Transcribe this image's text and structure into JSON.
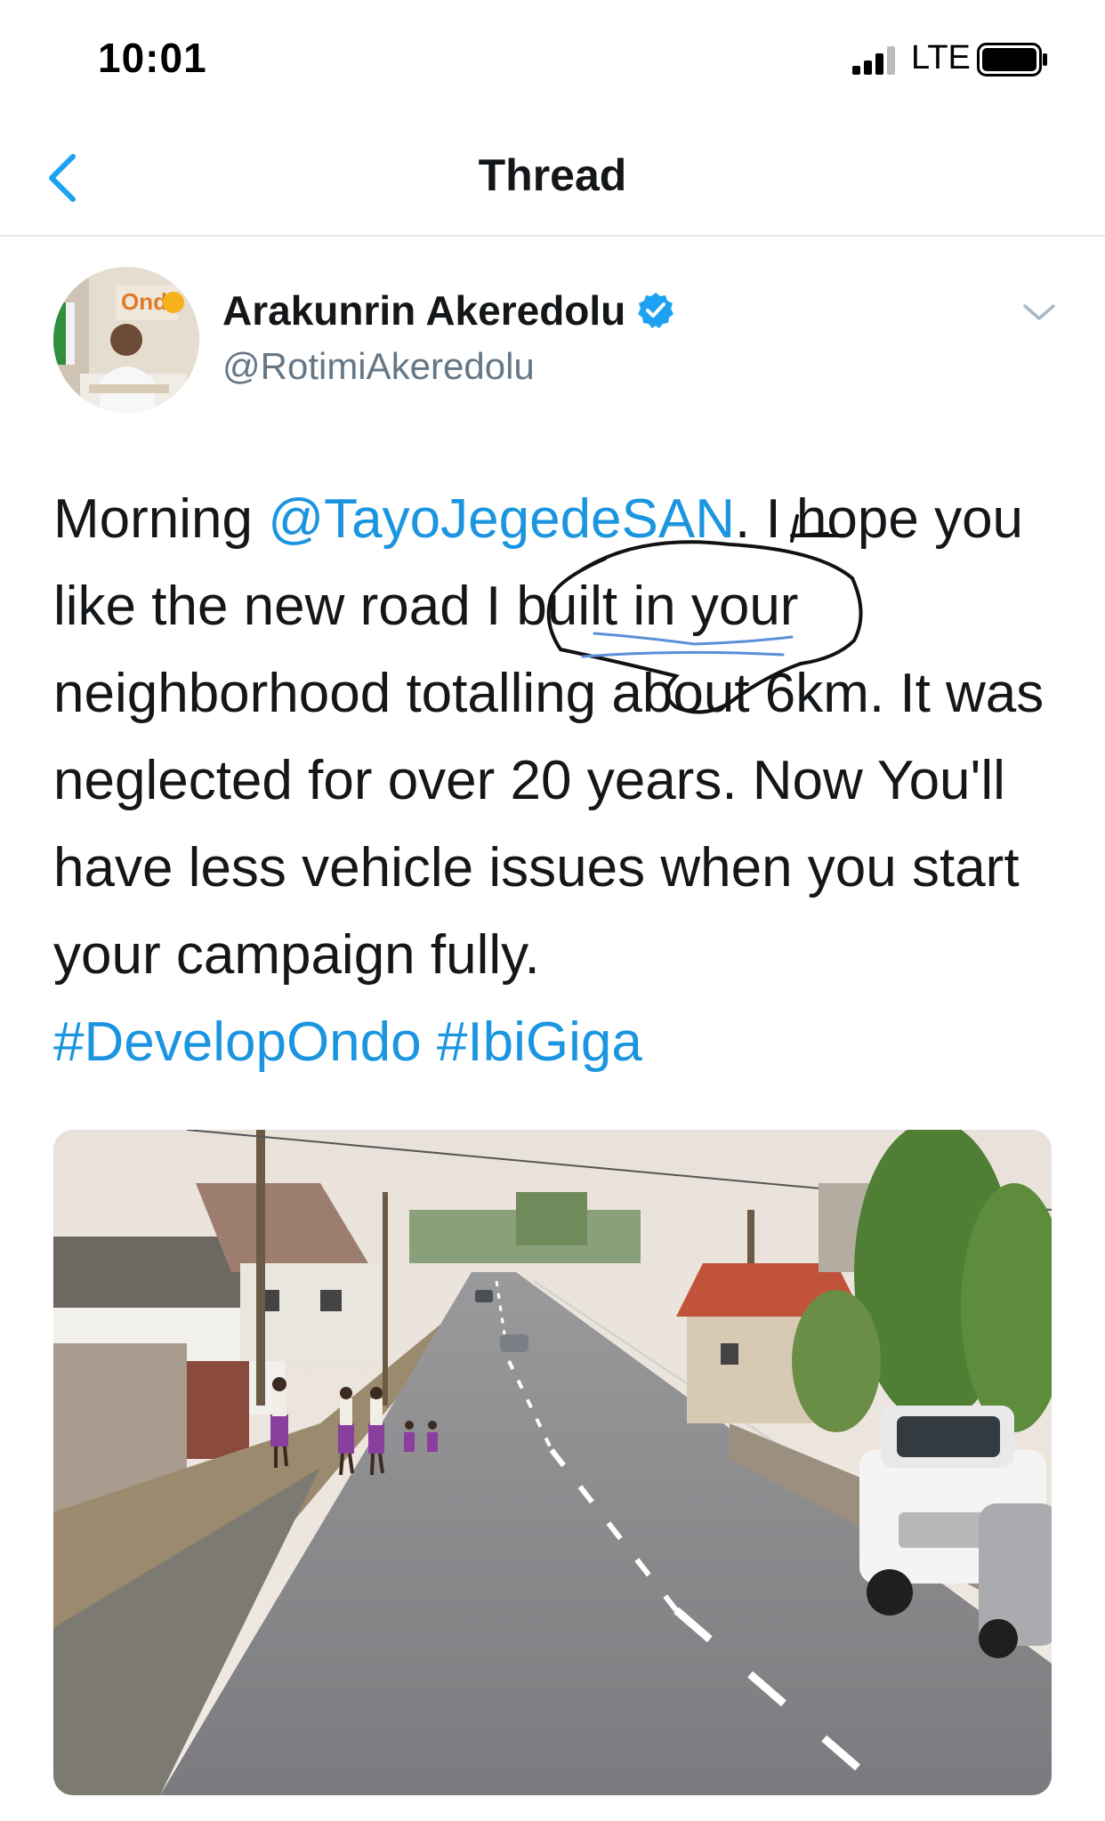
{
  "status_bar": {
    "time": "10:01",
    "network": "LTE",
    "icons": [
      "signal-icon",
      "battery-icon"
    ]
  },
  "nav": {
    "title": "Thread",
    "back_icon": "chevron-left-icon"
  },
  "tweet": {
    "author": {
      "display_name": "Arakunrin Akeredolu",
      "handle": "@RotimiAkeredolu",
      "verified": true
    },
    "text": {
      "p1": "Morning ",
      "mention": "@TayoJegedeSAN",
      "p2": ". I hope you like the new road I built in your neighborhood totalling about 6km. It was neglected for over 20 years. Now You'll have less vehicle issues when you start your campaign fully.",
      "hashtag1": "#DevelopOndo",
      "hashtag2": "#IbiGiga"
    },
    "menu_icon": "chevron-down-icon",
    "media": {
      "kind": "photo"
    }
  },
  "colors": {
    "link": "#1b95e0",
    "verified": "#1da1f2",
    "text": "#14171a",
    "secondary": "#657786",
    "divider": "#e1e8ed",
    "back": "#1da1f2"
  }
}
